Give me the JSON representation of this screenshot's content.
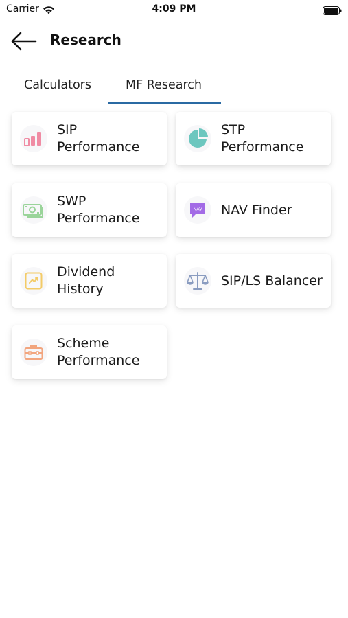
{
  "status_bar": {
    "carrier": "Carrier",
    "time": "4:09 PM"
  },
  "header": {
    "title": "Research"
  },
  "tabs": [
    {
      "label": "Calculators",
      "active": false
    },
    {
      "label": "MF Research",
      "active": true
    }
  ],
  "colors": {
    "tab_active_underline": "#2a6aa3",
    "sip_icon": "#f08ca4",
    "stp_icon": "#6cc7bf",
    "swp_icon": "#9ad49a",
    "nav_icon": "#a36be6",
    "dividend_icon": "#f3cb67",
    "balancer_icon": "#8a9cc0",
    "scheme_icon": "#f2a57e"
  },
  "cards": [
    {
      "label_line1": "SIP",
      "label_line2": "Performance",
      "icon": "bar-chart-icon"
    },
    {
      "label_line1": "STP",
      "label_line2": "Performance",
      "icon": "pie-chart-icon"
    },
    {
      "label_line1": "SWP",
      "label_line2": "Performance",
      "icon": "cash-icon"
    },
    {
      "label_line1": "NAV Finder",
      "label_line2": "",
      "icon": "nav-badge-icon",
      "icon_text": "NAV"
    },
    {
      "label_line1": "Dividend",
      "label_line2": "History",
      "icon": "trend-chart-icon"
    },
    {
      "label_line1": "SIP/LS Balancer",
      "label_line2": "",
      "icon": "scale-icon"
    },
    {
      "label_line1": "Scheme",
      "label_line2": "Performance",
      "icon": "briefcase-icon"
    }
  ]
}
